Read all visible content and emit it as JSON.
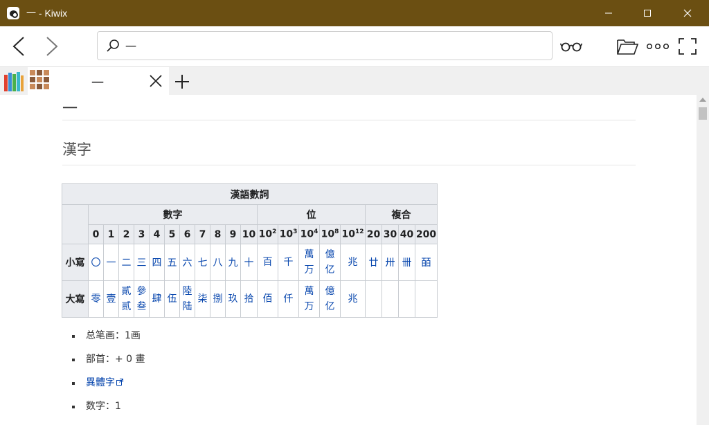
{
  "window": {
    "title": "一 - Kiwix"
  },
  "window_controls": {
    "minimize": "—",
    "maximize": "☐",
    "close": "✕"
  },
  "toolbar": {
    "search_value": "一",
    "icons": [
      "back-icon",
      "forward-icon",
      "search-icon",
      "reading-glasses-icon",
      "open-folder-icon",
      "more-icon",
      "fullscreen-icon"
    ]
  },
  "tabs": {
    "active_label": "一",
    "new_tab": "+"
  },
  "article": {
    "heading": "一",
    "section": "漢字",
    "table": {
      "title": "漢語數詞",
      "groups": [
        "數字",
        "位",
        "複合"
      ],
      "digit_cols": [
        "0",
        "1",
        "2",
        "3",
        "4",
        "5",
        "6",
        "7",
        "8",
        "9",
        "10"
      ],
      "place_cols": [
        {
          "base": "10",
          "exp": "2"
        },
        {
          "base": "10",
          "exp": "3"
        },
        {
          "base": "10",
          "exp": "4"
        },
        {
          "base": "10",
          "exp": "8"
        },
        {
          "base": "10",
          "exp": "12"
        }
      ],
      "compound_cols": [
        "20",
        "30",
        "40",
        "200"
      ],
      "rows": {
        "small": {
          "label": "小寫",
          "digits": [
            "〇",
            "一",
            "二",
            "三",
            "四",
            "五",
            "六",
            "七",
            "八",
            "九",
            "十"
          ],
          "places": [
            [
              "百"
            ],
            [
              "千"
            ],
            [
              "萬",
              "万"
            ],
            [
              "億",
              "亿"
            ],
            [
              "兆"
            ]
          ],
          "compounds": [
            "廿",
            "卅",
            "卌",
            "皕"
          ]
        },
        "big": {
          "label": "大寫",
          "digits": [
            [
              "零"
            ],
            [
              "壹"
            ],
            [
              "貳",
              "贰"
            ],
            [
              "參",
              "叁"
            ],
            [
              "肆"
            ],
            [
              "伍"
            ],
            [
              "陸",
              "陆"
            ],
            [
              "柒"
            ],
            [
              "捌"
            ],
            [
              "玖"
            ],
            [
              "拾"
            ]
          ],
          "places": [
            [
              "佰"
            ],
            [
              "仟"
            ],
            [
              "萬",
              "万"
            ],
            [
              "億",
              "亿"
            ],
            [
              "兆"
            ]
          ]
        }
      }
    },
    "facts": [
      {
        "text": "总笔画：1画",
        "link": false
      },
      {
        "text": "部首：+ 0 畫",
        "link": false
      },
      {
        "text": "異體字",
        "link": true
      },
      {
        "text": "数字：1",
        "link": false
      }
    ]
  },
  "colors": {
    "titlebar": "#6b4f12",
    "link": "#0645ad",
    "table_header": "#eaecf0",
    "table_border": "#c8ccd1"
  }
}
